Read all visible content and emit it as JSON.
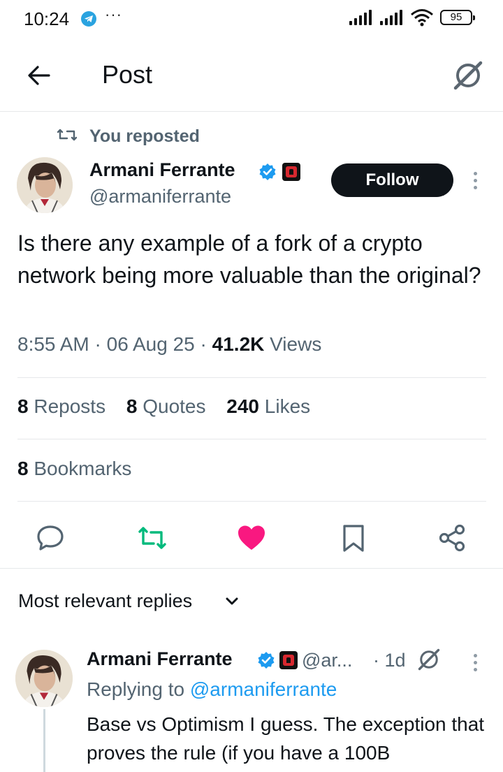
{
  "status_bar": {
    "time": "10:24",
    "telegram_icon": "telegram-icon",
    "more": "···",
    "battery": "95"
  },
  "header": {
    "title": "Post",
    "back_icon": "arrow-left-icon",
    "grok_icon": "grok-icon"
  },
  "post": {
    "repost_label": "You reposted",
    "author_name": "Armani Ferrante",
    "author_handle": "@armaniferrante",
    "follow_label": "Follow",
    "text": "Is there any example of a fork of a crypto network being more valuable than the original?",
    "time": "8:55 AM",
    "date": "06 Aug 25",
    "views_count": "41.2K",
    "views_label": "Views",
    "stats": {
      "reposts_count": "8",
      "reposts_label": "Reposts",
      "quotes_count": "8",
      "quotes_label": "Quotes",
      "likes_count": "240",
      "likes_label": "Likes",
      "bookmarks_count": "8",
      "bookmarks_label": "Bookmarks"
    },
    "liked": true,
    "colors": {
      "like": "#f91880",
      "repost": "#00ba7c",
      "link": "#1d9bf0",
      "verified": "#1d9bf0"
    }
  },
  "replies": {
    "sort_label": "Most relevant replies",
    "items": [
      {
        "author_name": "Armani Ferrante",
        "author_handle": "@ar...",
        "time": "1d",
        "replying_prefix": "Replying to",
        "replying_to": "@armaniferrante",
        "text": "Base vs Optimism I guess. The exception that proves the rule (if you have a 100B"
      }
    ]
  }
}
